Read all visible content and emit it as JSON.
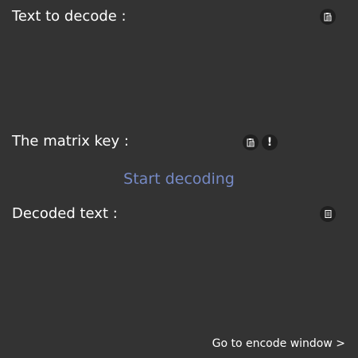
{
  "decode_input": {
    "label": "Text to decode :",
    "value": "",
    "paste_icon": "paste-icon"
  },
  "matrix_key": {
    "label": "The matrix key :",
    "paste_icon": "paste-icon",
    "info_icon": "exclamation-icon",
    "info_glyph": "!"
  },
  "actions": {
    "start_label": "Start decoding"
  },
  "decoded_output": {
    "label": "Decoded text :",
    "value": "",
    "copy_icon": "copy-icon"
  },
  "navigation": {
    "encode_link": "Go to encode window >"
  },
  "colors": {
    "background": "#333333",
    "text": "#ffffff",
    "accent": "#7589c4",
    "icon_bg": "#1f1f1f"
  }
}
